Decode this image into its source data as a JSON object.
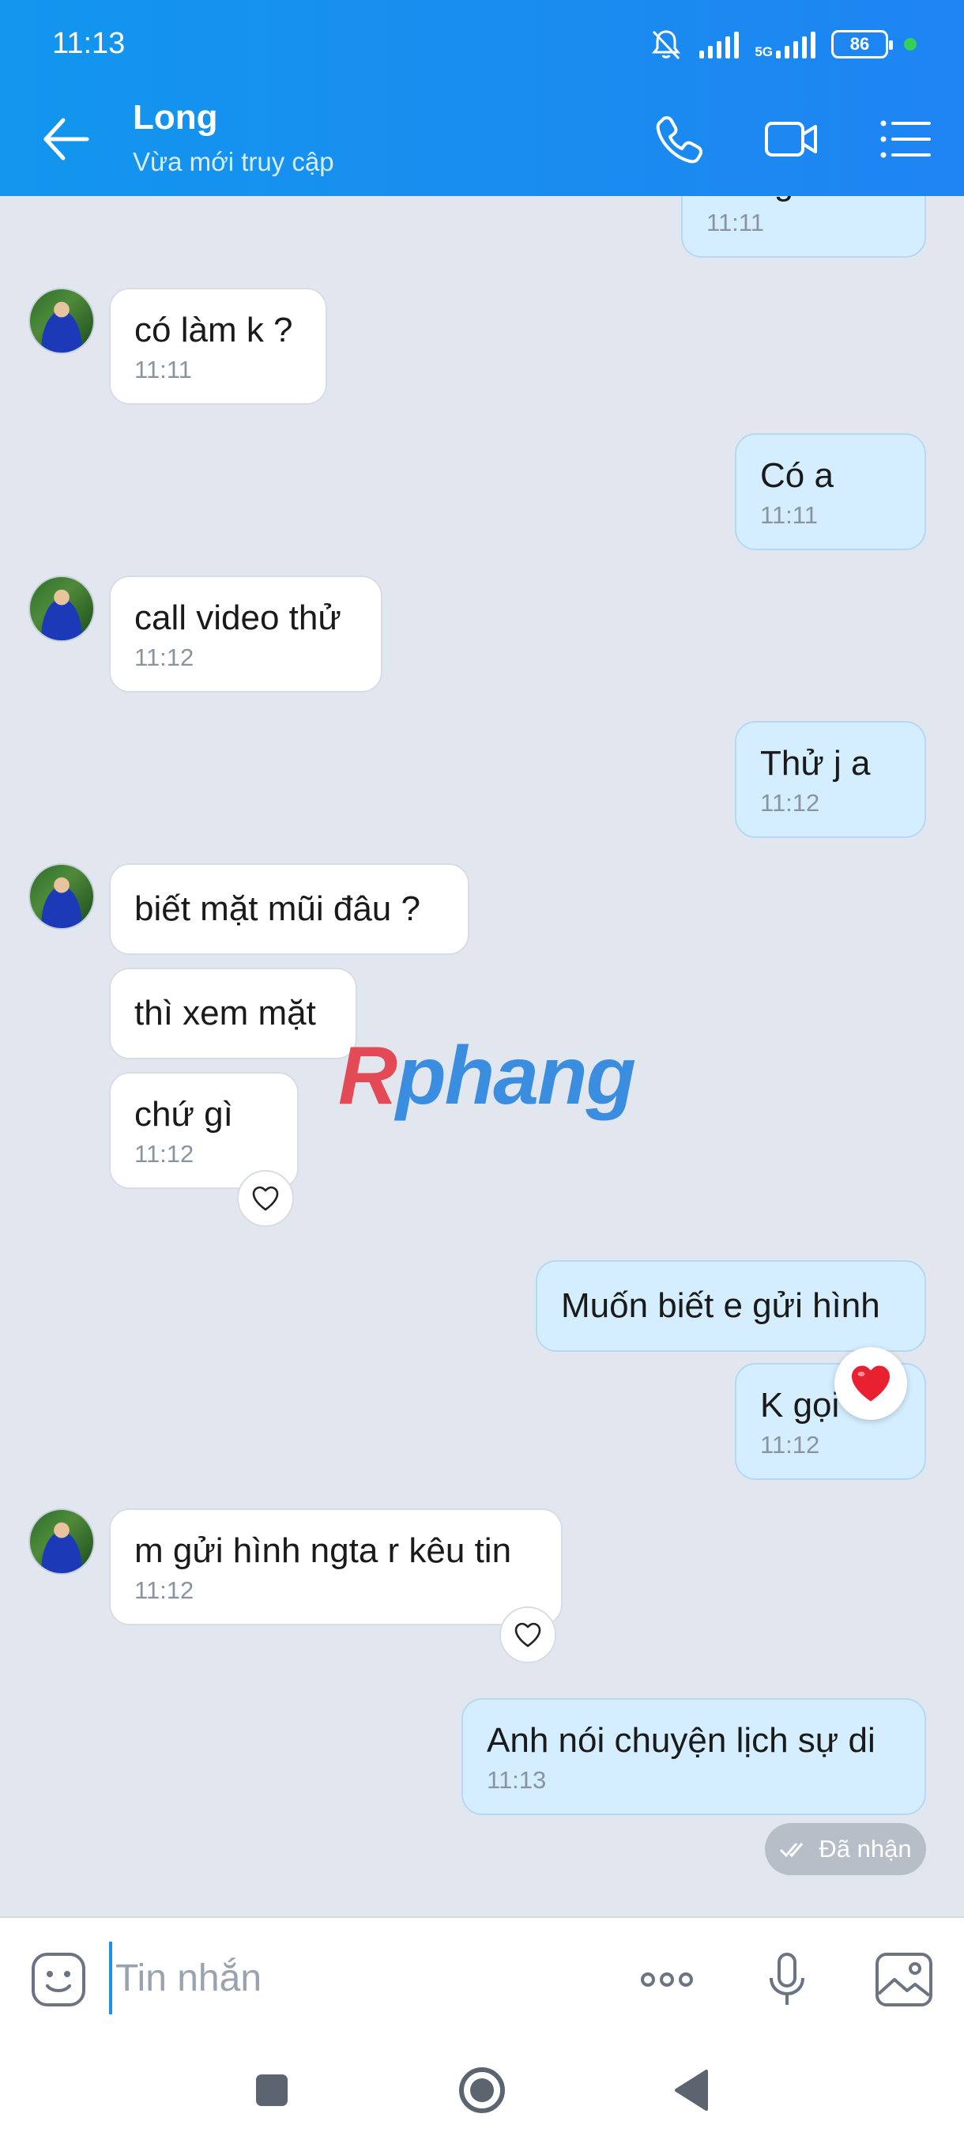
{
  "status_bar": {
    "time": "11:13",
    "network_label": "5G",
    "battery": "86"
  },
  "header": {
    "contact_name": "Long",
    "contact_status": "Vừa mới truy cập"
  },
  "messages": {
    "m0": {
      "text": "Hừng Phú ?",
      "time": "11:11"
    },
    "m1": {
      "text": "có làm k ?",
      "time": "11:11"
    },
    "m2": {
      "text": "Có a",
      "time": "11:11"
    },
    "m3": {
      "text": "call video thử",
      "time": "11:12"
    },
    "m4": {
      "text": "Thử j a",
      "time": "11:12"
    },
    "m5": {
      "text": "biết mặt mũi đâu ?"
    },
    "m6": {
      "text": "thì xem mặt"
    },
    "m7": {
      "text": "chứ gì",
      "time": "11:12"
    },
    "m8": {
      "text": "Muốn biết e gửi hình"
    },
    "m9": {
      "text": "K gọi",
      "time": "11:12"
    },
    "m10": {
      "text": "m gửi hình ngta r kêu tin",
      "time": "11:12"
    },
    "m11": {
      "text": "Anh nói chuyện lịch sự di",
      "time": "11:13"
    }
  },
  "read_status": "Đã nhận",
  "watermark": {
    "part1": "R",
    "part2": "phang"
  },
  "composer": {
    "placeholder": "Tin nhắn",
    "value": ""
  },
  "colors": {
    "header": "#1a8cf0",
    "outgoing_bubble": "#d4eeff",
    "incoming_bubble": "#ffffff",
    "background": "#e2e7ef",
    "heart": "#e8202f"
  },
  "icons": [
    "back-arrow-icon",
    "phone-icon",
    "video-call-icon",
    "menu-list-icon",
    "heart-outline-icon",
    "heart-filled-icon",
    "double-check-icon",
    "emoji-icon",
    "more-icon",
    "microphone-icon",
    "image-icon",
    "square-nav-icon",
    "home-nav-icon",
    "back-nav-icon"
  ]
}
